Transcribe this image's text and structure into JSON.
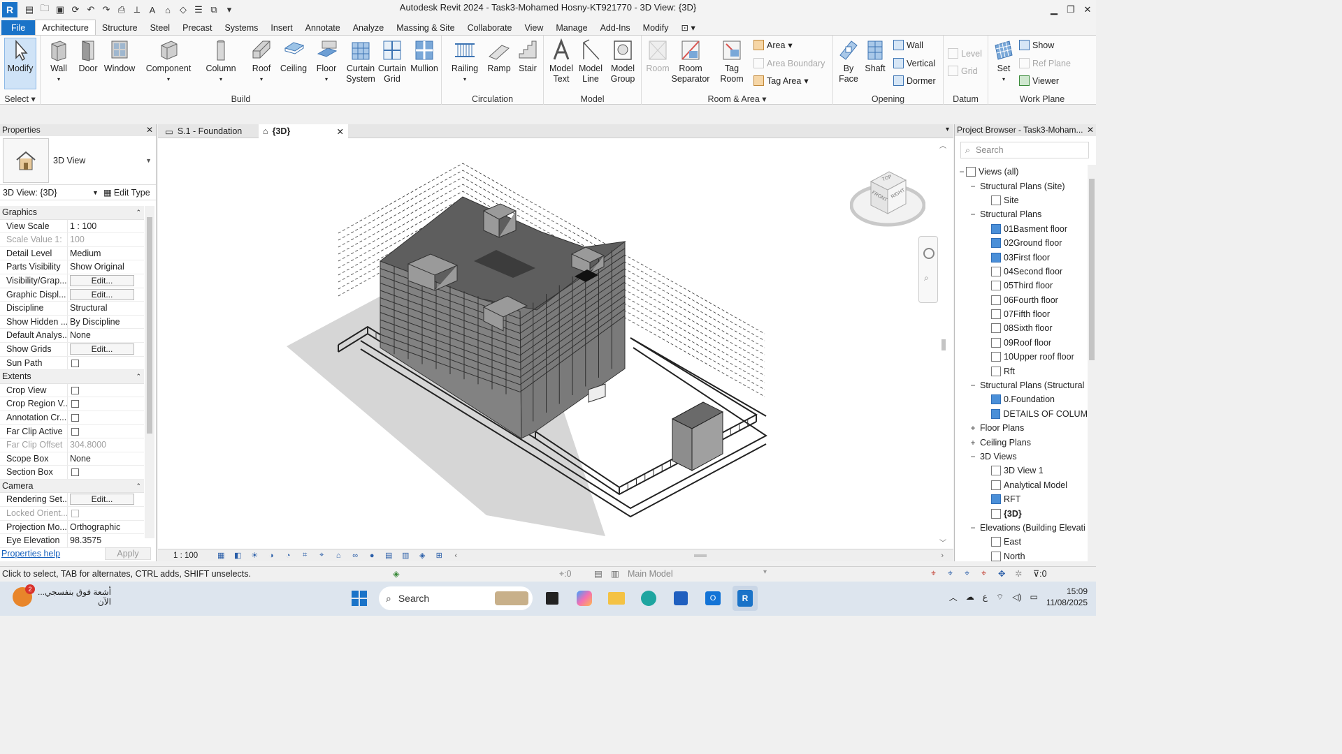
{
  "window": {
    "title": "Autodesk Revit 2024 - Task3-Mohamed Hosny-KT921770 - 3D View: {3D}",
    "logo": "R"
  },
  "ribbon_tabs": [
    "File",
    "Architecture",
    "Structure",
    "Steel",
    "Precast",
    "Systems",
    "Insert",
    "Annotate",
    "Analyze",
    "Massing & Site",
    "Collaborate",
    "View",
    "Manage",
    "Add-Ins",
    "Modify"
  ],
  "ribbon": {
    "select": {
      "modify": "Modify",
      "select": "Select"
    },
    "build": {
      "label": "Build",
      "buttons": [
        "Wall",
        "Door",
        "Window",
        "Component",
        "Column",
        "Roof",
        "Ceiling",
        "Floor",
        "Curtain\nSystem",
        "Curtain\nGrid",
        "Mullion"
      ]
    },
    "circulation": {
      "label": "Circulation",
      "buttons": [
        "Railing",
        "Ramp",
        "Stair"
      ]
    },
    "model": {
      "label": "Model",
      "buttons": [
        "Model\nText",
        "Model\nLine",
        "Model\nGroup"
      ]
    },
    "room_area": {
      "label": "Room & Area",
      "room": "Room",
      "room_separator": "Room\nSeparator",
      "tag_room": "Tag\nRoom",
      "area": "Area",
      "area_boundary": "Area  Boundary",
      "tag_area": "Tag  Area"
    },
    "opening": {
      "label": "Opening",
      "by_face": "By\nFace",
      "shaft": "Shaft",
      "wall": "Wall",
      "vertical": "Vertical",
      "dormer": "Dormer"
    },
    "datum": {
      "label": "Datum",
      "level": "Level",
      "grid": "Grid"
    },
    "work_plane": {
      "label": "Work Plane",
      "set": "Set",
      "show": "Show",
      "ref_plane": "Ref  Plane",
      "viewer": "Viewer"
    }
  },
  "properties": {
    "header": "Properties",
    "type_name": "3D View",
    "instance": "3D View: {3D}",
    "edit_type": "Edit Type",
    "sections": [
      {
        "name": "Graphics",
        "rows": [
          {
            "k": "View Scale",
            "v": "1 : 100"
          },
          {
            "k": "Scale Value    1:",
            "v": "100",
            "dis": true
          },
          {
            "k": "Detail Level",
            "v": "Medium"
          },
          {
            "k": "Parts Visibility",
            "v": "Show Original"
          },
          {
            "k": "Visibility/Grap...",
            "v": "Edit...",
            "btn": true
          },
          {
            "k": "Graphic Displ...",
            "v": "Edit...",
            "btn": true
          },
          {
            "k": "Discipline",
            "v": "Structural"
          },
          {
            "k": "Show Hidden ...",
            "v": "By Discipline"
          },
          {
            "k": "Default Analys...",
            "v": "None"
          },
          {
            "k": "Show Grids",
            "v": "Edit...",
            "btn": true
          },
          {
            "k": "Sun Path",
            "v": "",
            "chk": true
          }
        ]
      },
      {
        "name": "Extents",
        "rows": [
          {
            "k": "Crop View",
            "v": "",
            "chk": true
          },
          {
            "k": "Crop Region V...",
            "v": "",
            "chk": true
          },
          {
            "k": "Annotation Cr...",
            "v": "",
            "chk": true
          },
          {
            "k": "Far Clip Active",
            "v": "",
            "chk": true
          },
          {
            "k": "Far Clip Offset",
            "v": "304.8000",
            "dis": true
          },
          {
            "k": "Scope Box",
            "v": "None"
          },
          {
            "k": "Section Box",
            "v": "",
            "chk": true
          }
        ]
      },
      {
        "name": "Camera",
        "rows": [
          {
            "k": "Rendering Set...",
            "v": "Edit...",
            "btn": true
          },
          {
            "k": "Locked Orient...",
            "v": "",
            "chk": true,
            "dis": true
          },
          {
            "k": "Projection Mo...",
            "v": "Orthographic"
          },
          {
            "k": "Eye Elevation",
            "v": "98.3575"
          }
        ]
      }
    ],
    "help": "Properties help",
    "apply": "Apply"
  },
  "view_tabs": [
    {
      "label": "S.1 - Foundation",
      "active": false
    },
    {
      "label": "{3D}",
      "active": true
    }
  ],
  "viewcube": {
    "top": "TOP",
    "front": "FRONT",
    "right": "RIGHT"
  },
  "view_control": {
    "scale": "1 : 100"
  },
  "project_browser": {
    "header": "Project Browser - Task3-Moham...",
    "search_placeholder": "Search",
    "tree": [
      {
        "label": "Views (all)",
        "level": 0,
        "toggle": "−",
        "icon": "views"
      },
      {
        "label": "Structural Plans (Site)",
        "level": 1,
        "toggle": "−"
      },
      {
        "label": "Site",
        "level": 2,
        "icon": "plan"
      },
      {
        "label": "Structural Plans",
        "level": 1,
        "toggle": "−"
      },
      {
        "label": "01Basment floor",
        "level": 2,
        "icon": "plan-blue"
      },
      {
        "label": "02Ground floor",
        "level": 2,
        "icon": "plan-blue"
      },
      {
        "label": "03First floor",
        "level": 2,
        "icon": "plan-blue"
      },
      {
        "label": "04Second floor",
        "level": 2,
        "icon": "plan"
      },
      {
        "label": "05Third floor",
        "level": 2,
        "icon": "plan"
      },
      {
        "label": "06Fourth floor",
        "level": 2,
        "icon": "plan"
      },
      {
        "label": "07Fifth floor",
        "level": 2,
        "icon": "plan"
      },
      {
        "label": "08Sixth floor",
        "level": 2,
        "icon": "plan"
      },
      {
        "label": "09Roof floor",
        "level": 2,
        "icon": "plan"
      },
      {
        "label": "10Upper roof floor",
        "level": 2,
        "icon": "plan"
      },
      {
        "label": "Rft",
        "level": 2,
        "icon": "plan"
      },
      {
        "label": "Structural Plans (Structural",
        "level": 1,
        "toggle": "−"
      },
      {
        "label": "0.Foundation",
        "level": 2,
        "icon": "plan-blue"
      },
      {
        "label": "DETAILS OF COLUM",
        "level": 2,
        "icon": "plan-blue"
      },
      {
        "label": "Floor Plans",
        "level": 1,
        "toggle": "+"
      },
      {
        "label": "Ceiling Plans",
        "level": 1,
        "toggle": "+"
      },
      {
        "label": "3D Views",
        "level": 1,
        "toggle": "−"
      },
      {
        "label": "3D View 1",
        "level": 2,
        "icon": "plan"
      },
      {
        "label": "Analytical Model",
        "level": 2,
        "icon": "plan"
      },
      {
        "label": "RFT",
        "level": 2,
        "icon": "plan-blue"
      },
      {
        "label": "{3D}",
        "level": 2,
        "icon": "plan",
        "bold": true
      },
      {
        "label": "Elevations (Building Elevati",
        "level": 1,
        "toggle": "−"
      },
      {
        "label": "East",
        "level": 2,
        "icon": "plan"
      },
      {
        "label": "North",
        "level": 2,
        "icon": "plan"
      }
    ]
  },
  "status_bar": {
    "text": "Click to select, TAB for alternates, CTRL adds, SHIFT unselects.",
    "zero": ":0",
    "model": "Main Model",
    "filter": ":0"
  },
  "taskbar": {
    "news": "أشعة فوق بنفسجي...",
    "news_sub": "الآن",
    "badge": "2",
    "search": "Search",
    "lang": "ع",
    "time": "15:09",
    "date": "11/08/2025"
  },
  "colors": {
    "accent": "#1a73c8",
    "building": "#6d6d6d",
    "roof": "#5a5a5a"
  }
}
